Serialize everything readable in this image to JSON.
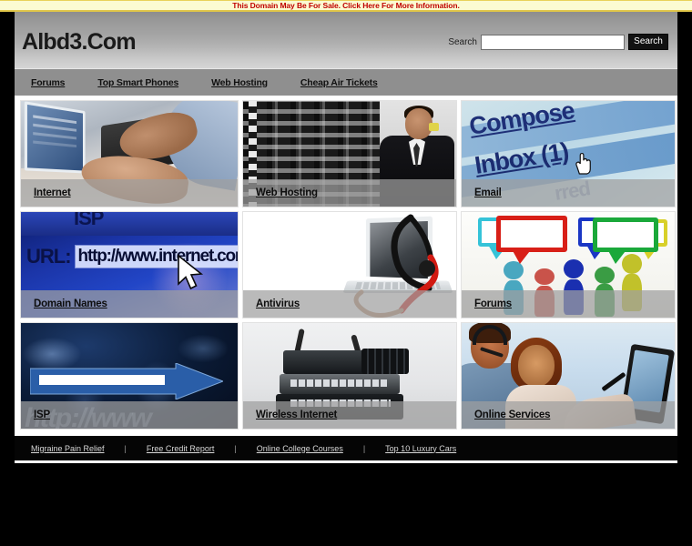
{
  "sale_banner": {
    "text": "This Domain May Be For Sale. Click Here For More Information."
  },
  "header": {
    "site_title": "Albd3.Com",
    "search_label": "Search",
    "search_value": "",
    "search_placeholder": "",
    "search_button": "Search"
  },
  "nav": {
    "items": [
      {
        "label": "Forums"
      },
      {
        "label": "Top Smart Phones"
      },
      {
        "label": "Web Hosting"
      },
      {
        "label": "Cheap Air Tickets"
      }
    ]
  },
  "tiles": [
    {
      "label": "Internet",
      "art": "internet"
    },
    {
      "label": "Web Hosting",
      "art": "hosting"
    },
    {
      "label": "Email",
      "art": "email"
    },
    {
      "label": "Domain Names",
      "art": "domain"
    },
    {
      "label": "Antivirus",
      "art": "antivirus"
    },
    {
      "label": "Forums",
      "art": "forums"
    },
    {
      "label": "ISP",
      "art": "isp"
    },
    {
      "label": "Wireless Internet",
      "art": "wireless"
    },
    {
      "label": "Online Services",
      "art": "online"
    }
  ],
  "tile_art_text": {
    "email_compose": "Compose",
    "email_inbox": "Inbox (1)",
    "email_faded": "rred",
    "domain_label": "URL:",
    "domain_url": "http://www.internet.com",
    "domain_top": "ISP",
    "isp_ghost": "http://www"
  },
  "footer": {
    "links": [
      {
        "label": "Migraine Pain Relief"
      },
      {
        "label": "Free Credit Report"
      },
      {
        "label": "Online College Courses"
      },
      {
        "label": "Top 10 Luxury Cars"
      }
    ],
    "separator": "|"
  },
  "colors": {
    "banner_bg": "#fbfbd2",
    "banner_text": "#c00000",
    "header_gray": "#a5a5a5",
    "nav_gray": "#8f8f8f",
    "footer_black": "#050505",
    "label_band": "rgba(160,160,160,0.72)"
  }
}
